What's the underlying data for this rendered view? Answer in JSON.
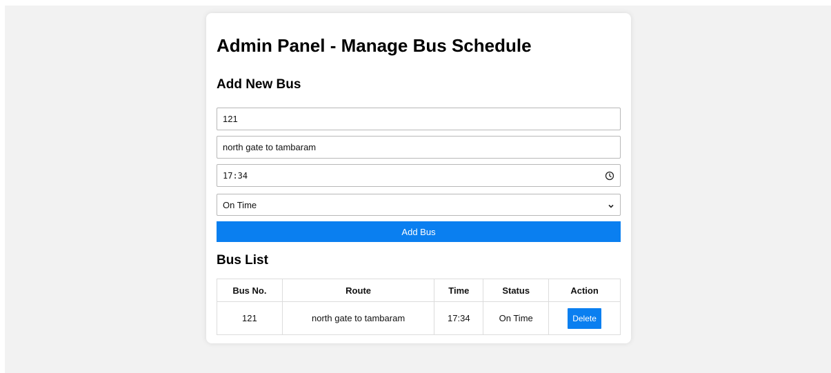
{
  "page": {
    "title": "Admin Panel - Manage Bus Schedule",
    "add_section_title": "Add New Bus",
    "list_section_title": "Bus List"
  },
  "form": {
    "bus_number": "121",
    "route": "north gate to tambaram",
    "time": "17:34",
    "status": "On Time",
    "add_button_label": "Add Bus"
  },
  "table": {
    "headers": [
      "Bus No.",
      "Route",
      "Time",
      "Status",
      "Action"
    ],
    "rows": [
      {
        "bus_no": "121",
        "route": "north gate to tambaram",
        "time": "17:34",
        "status": "On Time",
        "action_label": "Delete"
      }
    ]
  },
  "icons": {
    "time_field_icon": "clock-icon",
    "status_select_icon": "chevron-down-icon"
  },
  "colors": {
    "accent": "#0a7ff0",
    "page_background": "#f2f2f2",
    "panel_background": "#ffffff"
  }
}
